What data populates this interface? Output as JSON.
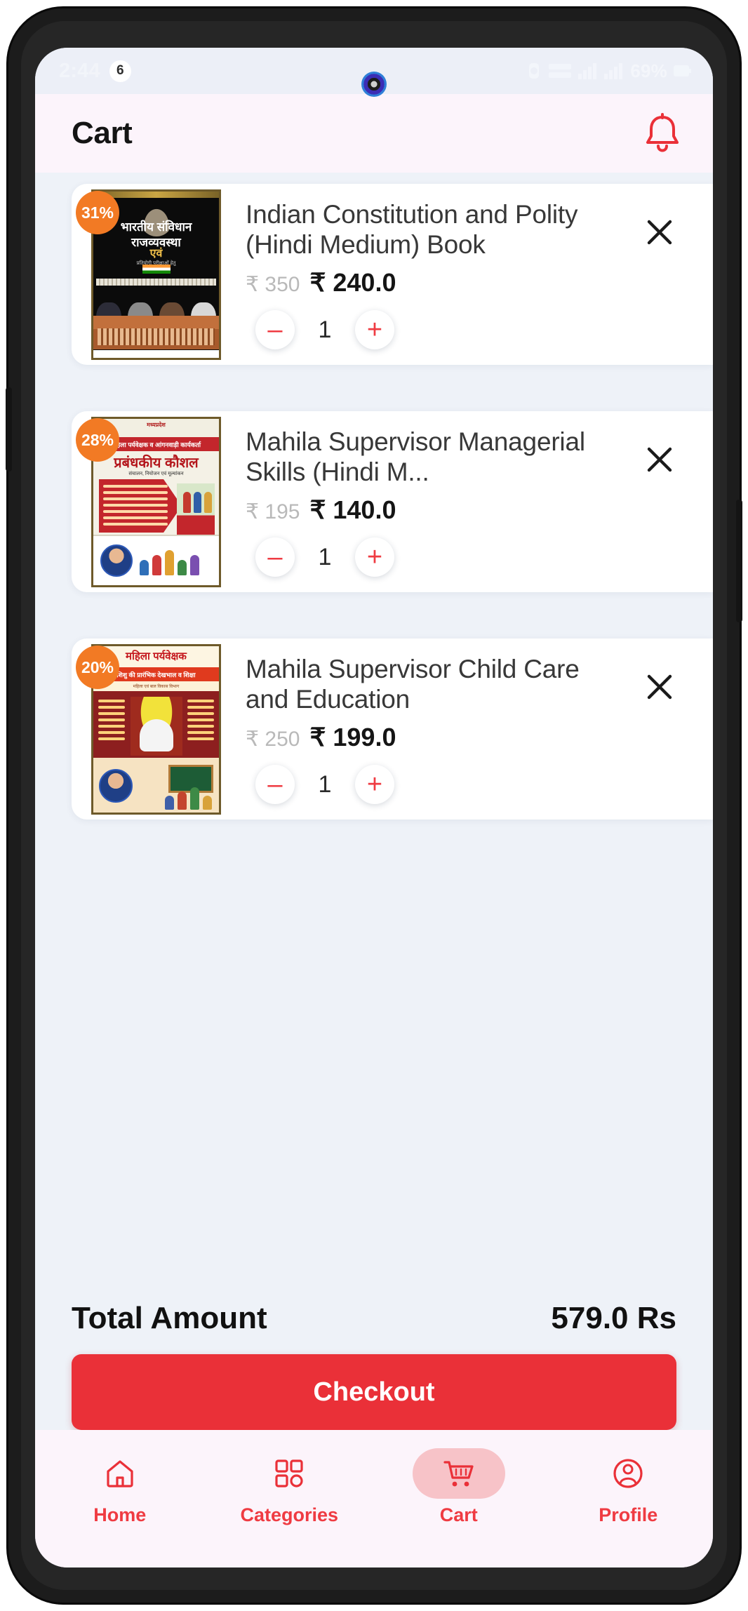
{
  "status_bar": {
    "clock": "2:44",
    "notification_badge": "6",
    "battery_text": "69%",
    "icons": [
      "alarm-icon",
      "vowifi-icon",
      "signal-bars-icon",
      "signal-bars-icon",
      "battery-icon"
    ]
  },
  "header": {
    "title": "Cart",
    "bell_icon": "notification-bell-icon"
  },
  "cart": {
    "items": [
      {
        "discount": "31%",
        "title": "Indian Constitution and Polity (Hindi Medium) Book",
        "price_old": "₹ 350",
        "price_new": "₹ 240.0",
        "quantity": "1",
        "decrement_label": "–",
        "increment_label": "+",
        "remove_label": "✕",
        "cover": {
          "style": "constitution",
          "line1": "भारतीय संविधान",
          "line2": "एवं",
          "line3": "राजव्यवस्था",
          "subtitle": "प्रतियोगी परीक्षाओं हेतु"
        }
      },
      {
        "discount": "28%",
        "title": "Mahila Supervisor Managerial Skills (Hindi M...",
        "price_old": "₹ 195",
        "price_new": "₹ 140.0",
        "quantity": "1",
        "decrement_label": "–",
        "increment_label": "+",
        "remove_label": "✕",
        "cover": {
          "style": "managerial",
          "line1": "मध्यप्रदेश",
          "line2": "महिला पर्यवेक्षक व आंगनवाड़ी कार्यकर्ता",
          "line3": "प्रबंधकीय कौशल",
          "subtitle": "संचालन, नियोजन एवं मूल्यांकन"
        }
      },
      {
        "discount": "20%",
        "title": "Mahila Supervisor Child Care and Education",
        "price_old": "₹ 250",
        "price_new": "₹ 199.0",
        "quantity": "1",
        "decrement_label": "–",
        "increment_label": "+",
        "remove_label": "✕",
        "cover": {
          "style": "childcare",
          "line1": "महिला पर्यवेक्षक",
          "line2": "शिशु की प्रारंभिक देखभाल व शिक्षा",
          "line3": "",
          "subtitle": "महिला एवं बाल विकास विभाग"
        }
      }
    ]
  },
  "footer": {
    "total_label": "Total Amount",
    "total_value": "579.0 Rs",
    "checkout_label": "Checkout"
  },
  "bottom_nav": {
    "items": [
      {
        "label": "Home",
        "icon": "home-icon",
        "active": false
      },
      {
        "label": "Categories",
        "icon": "grid-icon",
        "active": false
      },
      {
        "label": "Cart",
        "icon": "shopping-cart-icon",
        "active": true
      },
      {
        "label": "Profile",
        "icon": "user-profile-icon",
        "active": false
      }
    ]
  },
  "colors": {
    "accent_red": "#ea3038",
    "badge_orange": "#f27a24",
    "screen_bg": "#eef2f8",
    "header_bg": "#fcf4fb",
    "nav_active_pill": "#f7c3c8"
  }
}
